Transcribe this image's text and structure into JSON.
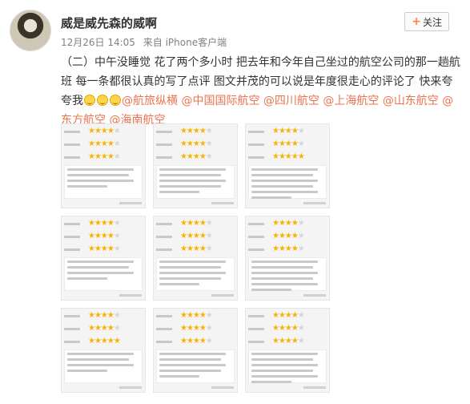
{
  "user": {
    "name": "威是威先森的威啊"
  },
  "meta": {
    "date": "12月26日 14:05",
    "source": "来自 iPhone客户端"
  },
  "follow": {
    "label": "关注"
  },
  "post": {
    "text_before": "（二）中午没睡觉 花了两个多小时 把去年和今年自己坐过的航空公司的那一趟航班 每一条都很认真的写了点评 图文并茂的可以说是年度很走心的评论了 快来夸夸我",
    "mentions": [
      "@航旅纵横",
      "@中国国际航空",
      "@四川航空",
      "@上海航空",
      "@山东航空",
      "@东方航空",
      "@海南航空"
    ]
  },
  "images": [
    {
      "ratings": [
        4,
        4,
        4
      ]
    },
    {
      "ratings": [
        4,
        4,
        4
      ]
    },
    {
      "ratings": [
        4,
        4,
        5
      ]
    },
    {
      "ratings": [
        4,
        4,
        4
      ]
    },
    {
      "ratings": [
        4,
        4,
        4
      ]
    },
    {
      "ratings": [
        4,
        4,
        4
      ]
    },
    {
      "ratings": [
        4,
        4,
        5
      ]
    },
    {
      "ratings": [
        4,
        4,
        4
      ]
    },
    {
      "ratings": [
        4,
        4,
        4
      ]
    }
  ],
  "icons": {
    "follow": "plus-icon",
    "emoji": "laughing-emoji-icon"
  },
  "colors": {
    "mention": "#eb7350",
    "follow_plus": "#ff8140",
    "star": "#f5b400"
  }
}
